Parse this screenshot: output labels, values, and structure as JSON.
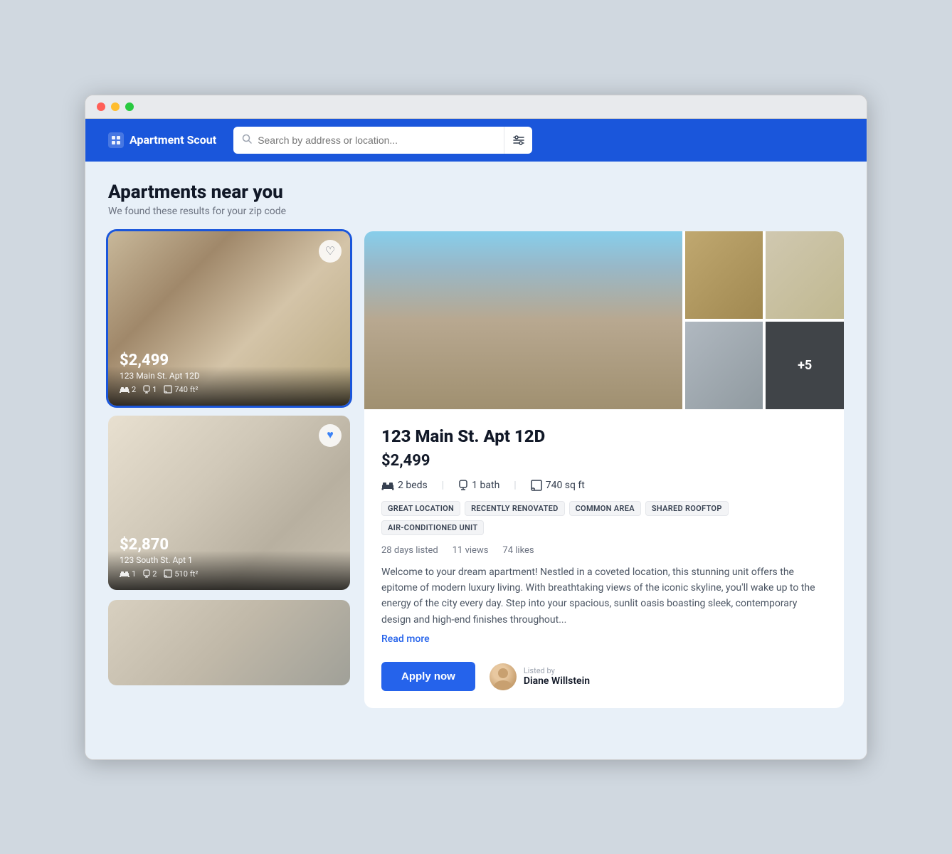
{
  "browser": {
    "dots": [
      "red",
      "yellow",
      "green"
    ]
  },
  "header": {
    "logo": "Apartment Scout",
    "logo_icon": "🏢",
    "search_placeholder": "Search by address or location...",
    "filter_icon": "⚙"
  },
  "page": {
    "title": "Apartments near you",
    "subtitle": "We found these results for your zip code"
  },
  "listings": [
    {
      "id": "apt1",
      "price": "$2,499",
      "address": "123 Main St. Apt 12D",
      "beds": "2",
      "baths": "1",
      "sqft": "740",
      "liked": false,
      "selected": true
    },
    {
      "id": "apt2",
      "price": "$2,870",
      "address": "123 South St. Apt 1",
      "beds": "1",
      "baths": "2",
      "sqft": "510",
      "liked": true,
      "selected": false
    },
    {
      "id": "apt3",
      "price": "",
      "address": "",
      "beds": "",
      "baths": "",
      "sqft": "",
      "liked": false,
      "selected": false,
      "partial": true
    }
  ],
  "detail": {
    "address": "123 Main St. Apt 12D",
    "price": "$2,499",
    "beds": "2 beds",
    "baths": "1 bath",
    "sqft": "740 sq ft",
    "tags": [
      "GREAT LOCATION",
      "RECENTLY RENOVATED",
      "COMMON AREA",
      "SHARED ROOFTOP",
      "AIR-CONDITIONED UNIT"
    ],
    "days_listed": "28 days listed",
    "views": "11 views",
    "likes": "74 likes",
    "description": "Welcome to your dream apartment! Nestled in a coveted location, this stunning unit offers the epitome of modern luxury living. With breathtaking views of the iconic skyline, you'll wake up to the energy of the city every day. Step into your spacious, sunlit oasis boasting sleek, contemporary design and high-end finishes throughout...",
    "read_more": "Read more",
    "apply_button": "Apply now",
    "agent_label": "Listed by",
    "agent_name": "Diane Willstein",
    "more_photos": "+5"
  }
}
